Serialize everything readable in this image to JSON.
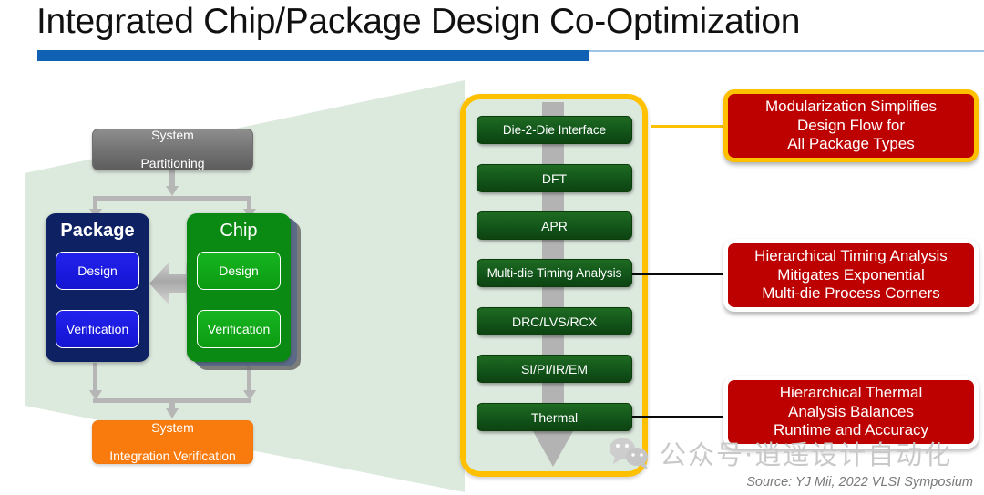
{
  "slide": {
    "title": "Integrated Chip/Package Design Co-Optimization",
    "source_note": "Source: YJ Mii, 2022 VLSI Symposium",
    "watermark_text": "公众号·逍遥设计自动化",
    "accent_blue": "#1060b4",
    "accent_yellow": "#ffc000",
    "callout_red": "#bd0000",
    "package_navy": "#0d2163",
    "chip_green": "#0a8a12",
    "orange": "#f97b0d",
    "flow_green": "#12551a",
    "backdrop_green": "#dce9dd"
  },
  "left_diagram": {
    "top_node": "System\nPartitioning",
    "top_node_line1": "System",
    "top_node_line2": "Partitioning",
    "bottom_node_line1": "System",
    "bottom_node_line2": "Integration Verification",
    "package": {
      "title": "Package",
      "items": [
        "Design",
        "Verification"
      ]
    },
    "chip": {
      "title": "Chip",
      "items": [
        "Design",
        "Verification"
      ]
    }
  },
  "flow": {
    "steps": [
      "Die-2-Die Interface",
      "DFT",
      "APR",
      "Multi-die Timing Analysis",
      "DRC/LVS/RCX",
      "SI/PI/IR/EM",
      "Thermal"
    ]
  },
  "callouts": [
    {
      "lines": [
        "Modularization Simplifies",
        "Design Flow for",
        "All Package Types"
      ],
      "border": "yellow",
      "connects_to": "Die-2-Die Interface"
    },
    {
      "lines": [
        "Hierarchical Timing Analysis",
        "Mitigates Exponential",
        "Multi-die Process Corners"
      ],
      "border": "white",
      "connects_to": "Multi-die Timing Analysis"
    },
    {
      "lines": [
        "Hierarchical Thermal",
        "Analysis Balances",
        "Runtime and Accuracy"
      ],
      "border": "white",
      "connects_to": "Thermal"
    }
  ]
}
